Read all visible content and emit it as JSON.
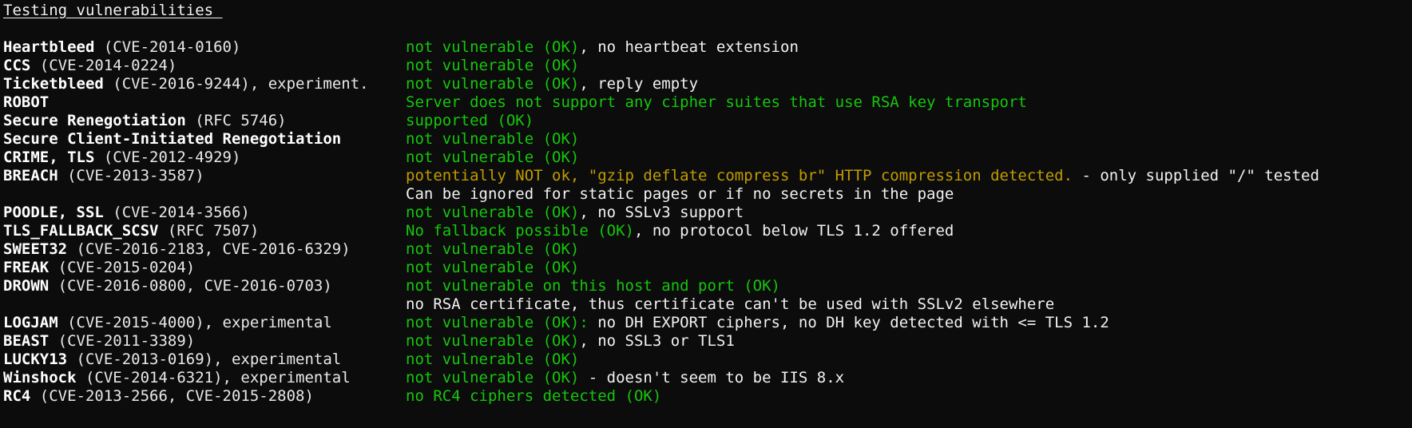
{
  "colors": {
    "background": "#0c0c0c",
    "text": "#f2f2f2",
    "ok_green": "#16c60c",
    "warning_yellow": "#c19c00"
  },
  "heading": "Testing vulnerabilities ",
  "rows": [
    {
      "name": "Heartbleed",
      "cve": " (CVE-2014-0160)",
      "result_ok": "not vulnerable (OK)",
      "result_extra": ", no heartbeat extension"
    },
    {
      "name": "CCS",
      "cve": " (CVE-2014-0224)",
      "result_ok": "not vulnerable (OK)",
      "result_extra": ""
    },
    {
      "name": "Ticketbleed",
      "cve": " (CVE-2016-9244), experiment.",
      "result_ok": "not vulnerable (OK)",
      "result_extra": ", reply empty"
    },
    {
      "name": "ROBOT",
      "cve": "",
      "result_ok": "Server does not support any cipher suites that use RSA key transport",
      "result_extra": ""
    },
    {
      "name": "Secure Renegotiation",
      "cve": " (RFC 5746)",
      "result_ok": "supported (OK)",
      "result_extra": ""
    },
    {
      "name": "Secure Client-Initiated Renegotiation",
      "cve": "",
      "result_ok": "not vulnerable (OK)",
      "result_extra": ""
    },
    {
      "name": "CRIME, TLS",
      "cve": " (CVE-2012-4929)",
      "result_ok": "not vulnerable (OK)",
      "result_extra": ""
    }
  ],
  "breach": {
    "name": "BREACH",
    "cve": " (CVE-2013-3587)",
    "result_warn": "potentially NOT ok, \"gzip deflate compress br\" HTTP compression detected.",
    "result_extra": " - only supplied \"/\" tested",
    "continuation": "Can be ignored for static pages or if no secrets in the page"
  },
  "rows2": [
    {
      "name": "POODLE, SSL",
      "cve": " (CVE-2014-3566)",
      "result_ok": "not vulnerable (OK)",
      "result_extra": ", no SSLv3 support"
    },
    {
      "name": "TLS_FALLBACK_SCSV",
      "cve": " (RFC 7507)",
      "result_ok": "No fallback possible (OK)",
      "result_extra": ", no protocol below TLS 1.2 offered"
    },
    {
      "name": "SWEET32",
      "cve": " (CVE-2016-2183, CVE-2016-6329)",
      "result_ok": "not vulnerable (OK)",
      "result_extra": ""
    },
    {
      "name": "FREAK",
      "cve": " (CVE-2015-0204)",
      "result_ok": "not vulnerable (OK)",
      "result_extra": ""
    }
  ],
  "drown": {
    "name": "DROWN",
    "cve": " (CVE-2016-0800, CVE-2016-0703)",
    "result_ok": "not vulnerable on this host and port (OK)",
    "continuation": "no RSA certificate, thus certificate can't be used with SSLv2 elsewhere"
  },
  "rows3": [
    {
      "name": "LOGJAM",
      "cve": " (CVE-2015-4000), experimental",
      "result_ok": "not vulnerable (OK):",
      "result_extra": " no DH EXPORT ciphers, no DH key detected with <= TLS 1.2"
    },
    {
      "name": "BEAST",
      "cve": " (CVE-2011-3389)",
      "result_ok": "not vulnerable (OK)",
      "result_extra": ", no SSL3 or TLS1"
    },
    {
      "name": "LUCKY13",
      "cve": " (CVE-2013-0169), experimental",
      "result_ok": "not vulnerable (OK)",
      "result_extra": ""
    },
    {
      "name": "Winshock",
      "cve": " (CVE-2014-6321), experimental",
      "result_ok": "not vulnerable (OK)",
      "result_extra": " - doesn't seem to be IIS 8.x"
    },
    {
      "name": "RC4",
      "cve": " (CVE-2013-2566, CVE-2015-2808)",
      "result_ok": "no RC4 ciphers detected (OK)",
      "result_extra": ""
    }
  ]
}
